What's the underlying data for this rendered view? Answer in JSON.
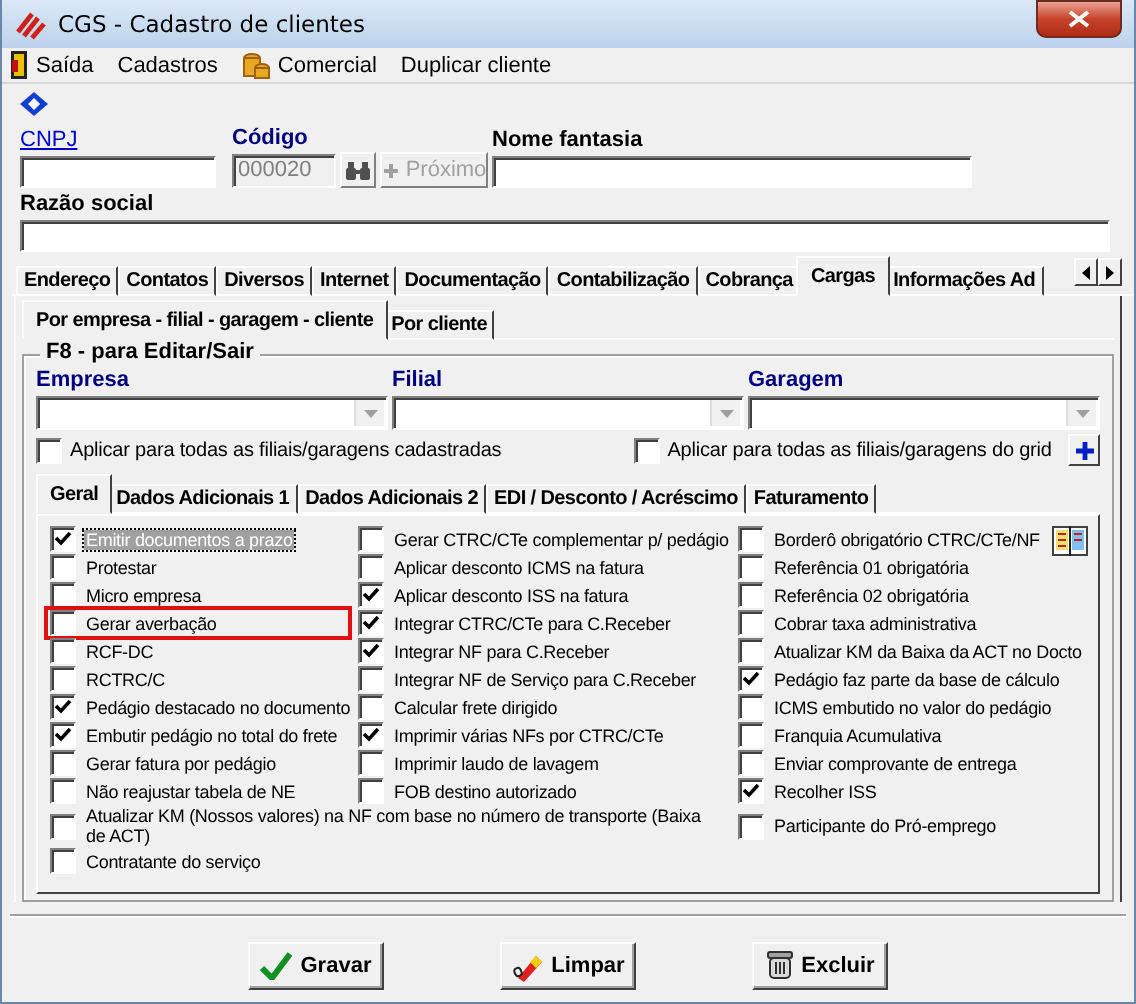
{
  "window": {
    "title": "CGS - Cadastro de clientes"
  },
  "menu": [
    {
      "label": "Saída"
    },
    {
      "label": "Cadastros"
    },
    {
      "label": "Comercial"
    },
    {
      "label": "Duplicar cliente"
    }
  ],
  "header": {
    "cnpj": {
      "label": "CNPJ"
    },
    "codigo": {
      "label": "Código",
      "value": "000020",
      "disabled": true
    },
    "next_button": {
      "label": "Próximo",
      "disabled": true
    },
    "nome_fantasia": {
      "label": "Nome fantasia"
    },
    "razao_social": {
      "label": "Razão social"
    }
  },
  "main_tabs": [
    {
      "label": "Endereço",
      "selected": false
    },
    {
      "label": "Contatos",
      "selected": false
    },
    {
      "label": "Diversos",
      "selected": false
    },
    {
      "label": "Internet",
      "selected": false
    },
    {
      "label": "Documentação",
      "selected": false
    },
    {
      "label": "Contabilização",
      "selected": false
    },
    {
      "label": "Cobrança",
      "selected": false
    },
    {
      "label": "Cargas",
      "selected": true
    },
    {
      "label": "Informações Ad",
      "selected": false
    }
  ],
  "sub_tabs": [
    {
      "label": "Por empresa - filial - garagem - cliente",
      "selected": true
    },
    {
      "label": "Por cliente",
      "selected": false
    }
  ],
  "filter_group": {
    "title": "F8 - para Editar/Sair",
    "dropdowns": [
      {
        "label": "Empresa"
      },
      {
        "label": "Filial"
      },
      {
        "label": "Garagem"
      }
    ],
    "checks": [
      {
        "label": "Aplicar para todas as filiais/garagens cadastradas",
        "checked": false
      },
      {
        "label": "Aplicar para todas as filiais/garagens do grid",
        "checked": false
      }
    ]
  },
  "option_tabs": [
    {
      "label": "Geral",
      "selected": true
    },
    {
      "label": "Dados Adicionais 1",
      "selected": false
    },
    {
      "label": "Dados Adicionais 2",
      "selected": false
    },
    {
      "label": "EDI / Desconto / Acréscimo",
      "selected": false
    },
    {
      "label": "Faturamento",
      "selected": false
    }
  ],
  "options": [
    [
      {
        "label": "Emitir documentos a prazo",
        "checked": true,
        "focused": true,
        "highlighted": false
      },
      {
        "label": "Gerar CTRC/CTe complementar p/ pedágio",
        "checked": false,
        "focused": false,
        "highlighted": false
      },
      {
        "label": "Borderô obrigatório  CTRC/CTe/NF",
        "checked": false,
        "focused": false,
        "highlighted": false
      }
    ],
    [
      {
        "label": "Protestar",
        "checked": false,
        "focused": false,
        "highlighted": false
      },
      {
        "label": "Aplicar desconto ICMS na fatura",
        "checked": false,
        "focused": false,
        "highlighted": false
      },
      {
        "label": "Referência 01 obrigatória",
        "checked": false,
        "focused": false,
        "highlighted": false
      }
    ],
    [
      {
        "label": "Micro empresa",
        "checked": false,
        "focused": false,
        "highlighted": false
      },
      {
        "label": "Aplicar desconto ISS na fatura",
        "checked": true,
        "focused": false,
        "highlighted": false
      },
      {
        "label": "Referência 02 obrigatória",
        "checked": false,
        "focused": false,
        "highlighted": false
      }
    ],
    [
      {
        "label": "Gerar averbação",
        "checked": false,
        "focused": false,
        "highlighted": true
      },
      {
        "label": "Integrar CTRC/CTe para C.Receber",
        "checked": true,
        "focused": false,
        "highlighted": false
      },
      {
        "label": "Cobrar taxa administrativa",
        "checked": false,
        "focused": false,
        "highlighted": false
      }
    ],
    [
      {
        "label": "RCF-DC",
        "checked": false,
        "focused": false,
        "highlighted": false
      },
      {
        "label": "Integrar NF para C.Receber",
        "checked": true,
        "focused": false,
        "highlighted": false
      },
      {
        "label": "Atualizar KM da Baixa da ACT no Docto",
        "checked": false,
        "focused": false,
        "highlighted": false
      }
    ],
    [
      {
        "label": "RCTRC/C",
        "checked": false,
        "focused": false,
        "highlighted": false
      },
      {
        "label": "Integrar NF de Serviço para C.Receber",
        "checked": false,
        "focused": false,
        "highlighted": false
      },
      {
        "label": "Pedágio faz parte da base de cálculo",
        "checked": true,
        "focused": false,
        "highlighted": false
      }
    ],
    [
      {
        "label": "Pedágio destacado no documento",
        "checked": true,
        "focused": false,
        "highlighted": false
      },
      {
        "label": "Calcular frete dirigido",
        "checked": false,
        "focused": false,
        "highlighted": false
      },
      {
        "label": "ICMS embutido no valor do pedágio",
        "checked": false,
        "focused": false,
        "highlighted": false
      }
    ],
    [
      {
        "label": "Embutir pedágio no total do frete",
        "checked": true,
        "focused": false,
        "highlighted": false
      },
      {
        "label": "Imprimir várias NFs por CTRC/CTe",
        "checked": true,
        "focused": false,
        "highlighted": false
      },
      {
        "label": "Franquia Acumulativa",
        "checked": false,
        "focused": false,
        "highlighted": false
      }
    ],
    [
      {
        "label": "Gerar fatura por pedágio",
        "checked": false,
        "focused": false,
        "highlighted": false
      },
      {
        "label": "Imprimir laudo de lavagem",
        "checked": false,
        "focused": false,
        "highlighted": false
      },
      {
        "label": "Enviar comprovante de entrega",
        "checked": false,
        "focused": false,
        "highlighted": false
      }
    ],
    [
      {
        "label": "Não reajustar tabela de NE",
        "checked": false,
        "focused": false,
        "highlighted": false
      },
      {
        "label": "FOB destino autorizado",
        "checked": false,
        "focused": false,
        "highlighted": false
      },
      {
        "label": "Recolher ISS",
        "checked": true,
        "focused": false,
        "highlighted": false
      }
    ],
    [
      {
        "label": "Atualizar KM (Nossos valores) na NF com base no número de transporte (Baixa de ACT)",
        "checked": false,
        "focused": false,
        "highlighted": false
      },
      {
        "label": "Participante do Pró-emprego",
        "checked": false,
        "focused": false,
        "highlighted": false
      }
    ],
    [
      {
        "label": "Contratante do serviço",
        "checked": false,
        "focused": false,
        "highlighted": false
      }
    ]
  ],
  "buttons": [
    {
      "label": "Gravar"
    },
    {
      "label": "Limpar"
    },
    {
      "label": "Excluir"
    }
  ]
}
